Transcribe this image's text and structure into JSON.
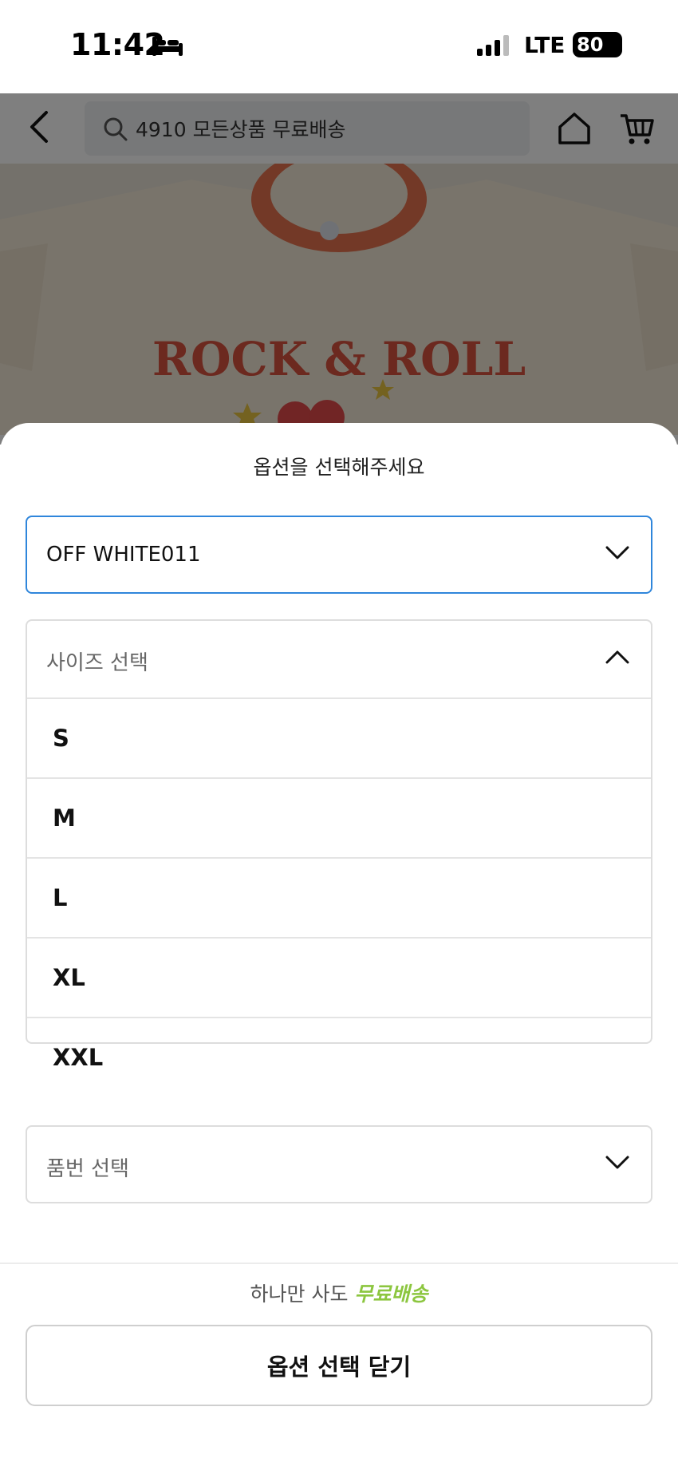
{
  "status_bar": {
    "time": "11:42",
    "network": "LTE",
    "battery": "80"
  },
  "header": {
    "search_text": "4910 모든상품 무료배송"
  },
  "product_image": {
    "print_text": "ROCK & ROLL"
  },
  "sheet": {
    "title": "옵션을 선택해주세요",
    "color_select": {
      "value": "OFF WHITE011"
    },
    "size_select": {
      "placeholder": "사이즈 선택",
      "options": [
        "S",
        "M",
        "L",
        "XL",
        "XXL"
      ]
    },
    "number_select": {
      "placeholder": "품번 선택"
    },
    "promo": {
      "text": "하나만 사도",
      "accent": "무료배송",
      "accent_color": "#8cc63f"
    },
    "close_button_label": "옵션 선택 닫기"
  },
  "colors": {
    "active_border": "#2f86db"
  }
}
